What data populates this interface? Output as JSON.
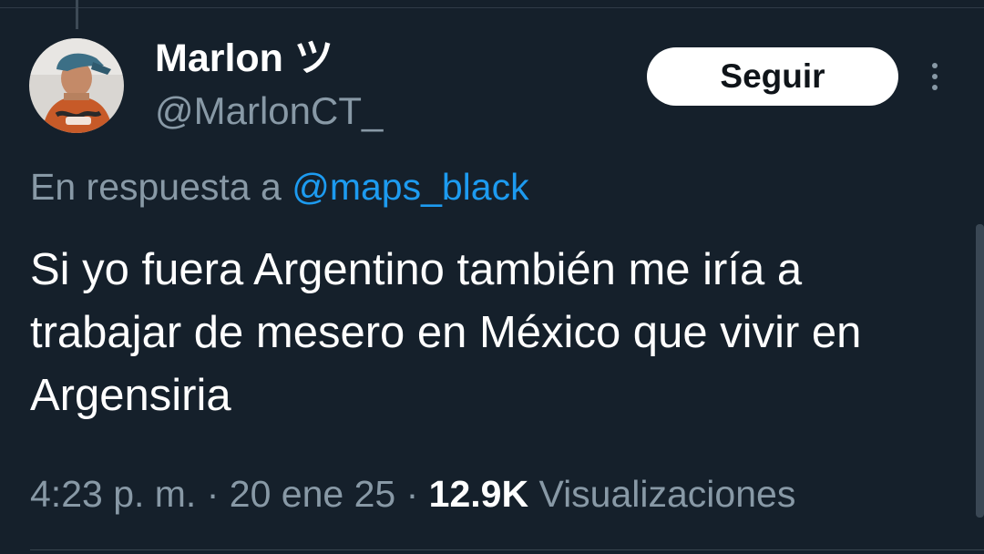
{
  "tweet": {
    "author": {
      "display_name": "Marlon ツ",
      "handle": "@MarlonCT_"
    },
    "follow_label": "Seguir",
    "reply_prefix": "En respuesta a",
    "reply_to": "@maps_black",
    "text": "Si yo fuera Argentino también me iría a trabajar de mesero en México que vivir en Argensiria",
    "time": "4:23 p. m.",
    "date": "20 ene 25",
    "views_count": "12.9K",
    "views_label": "Visualizaciones"
  },
  "icons": {
    "more": "more-vertical-icon"
  },
  "colors": {
    "background": "#15202b",
    "text_primary": "#ffffff",
    "text_secondary": "#8899a6",
    "link": "#1d9bf0",
    "button_bg": "#ffffff"
  }
}
